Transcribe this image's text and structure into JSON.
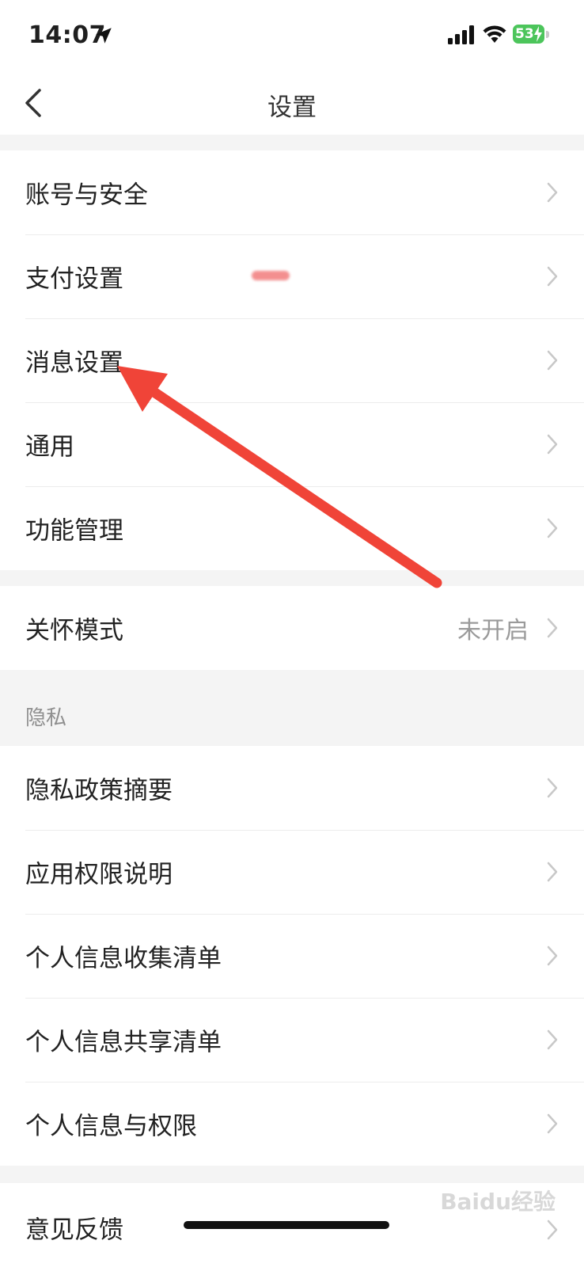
{
  "status_bar": {
    "time": "14:07",
    "battery_level": "53"
  },
  "nav": {
    "title": "设置"
  },
  "groups": {
    "main": [
      {
        "label": "账号与安全"
      },
      {
        "label": "支付设置"
      },
      {
        "label": "消息设置"
      },
      {
        "label": "通用"
      },
      {
        "label": "功能管理"
      }
    ],
    "care": {
      "label": "关怀模式",
      "value": "未开启"
    },
    "privacy_header": "隐私",
    "privacy": [
      {
        "label": "隐私政策摘要"
      },
      {
        "label": "应用权限说明"
      },
      {
        "label": "个人信息收集清单"
      },
      {
        "label": "个人信息共享清单"
      },
      {
        "label": "个人信息与权限"
      }
    ],
    "feedback": {
      "label": "意见反馈"
    }
  },
  "annotation": {
    "arrow_color": "#f04438",
    "target": "消息设置"
  },
  "watermark": "Baidu经验",
  "colors": {
    "background": "#f4f4f4",
    "row": "#ffffff",
    "battery": "#4cc55b"
  }
}
